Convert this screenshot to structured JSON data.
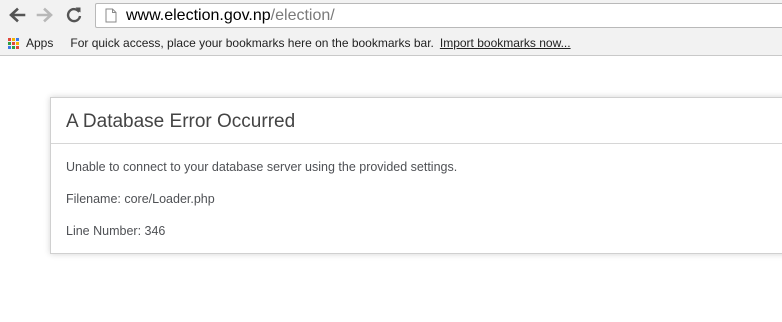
{
  "browser": {
    "url_host": "www.election.gov.np",
    "url_path": "/election/",
    "icons": {
      "back": "back-arrow-icon",
      "forward": "forward-arrow-icon",
      "reload": "reload-icon",
      "page": "page-icon",
      "apps": "apps-grid-icon"
    }
  },
  "bookmarks_bar": {
    "apps_label": "Apps",
    "hint_text": "For quick access, place your bookmarks here on the bookmarks bar.",
    "import_link": "Import bookmarks now..."
  },
  "error": {
    "title": "A Database Error Occurred",
    "message": "Unable to connect to your database server using the provided settings.",
    "filename": "Filename: core/Loader.php",
    "line_number": "Line Number: 346"
  },
  "colors": {
    "chrome_bg": "#f2f2f2",
    "title_text": "#444444",
    "body_text": "#4f5155",
    "url_path_text": "#7a7a7a",
    "apps_red": "#e0473c",
    "apps_yellow": "#f4b400",
    "apps_green": "#2f9e44",
    "apps_blue": "#3b78e7"
  }
}
